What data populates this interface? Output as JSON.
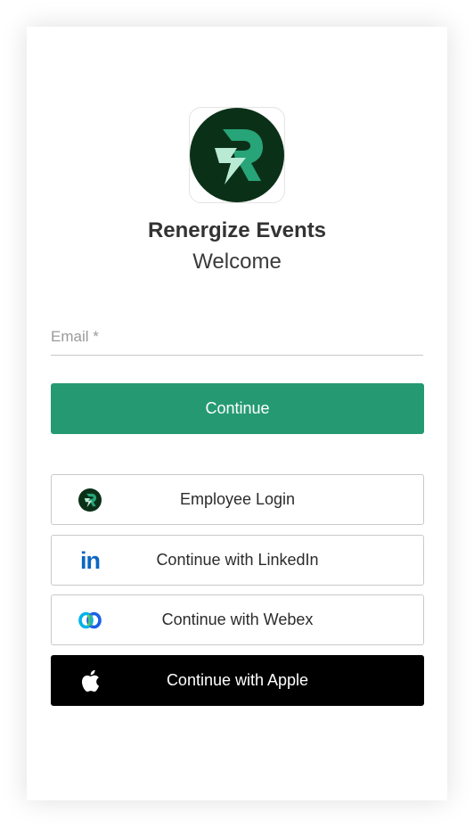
{
  "brand": {
    "name": "Renergize Events",
    "welcome": "Welcome"
  },
  "email": {
    "placeholder": "Email *",
    "value": ""
  },
  "continue_label": "Continue",
  "sso": [
    {
      "label": "Employee Login",
      "icon": "renergize-logo-icon"
    },
    {
      "label": "Continue with LinkedIn",
      "icon": "linkedin-icon"
    },
    {
      "label": "Continue with Webex",
      "icon": "webex-icon"
    },
    {
      "label": "Continue with Apple",
      "icon": "apple-icon"
    }
  ],
  "colors": {
    "primary": "#259a72",
    "logo_bg": "#0b3018",
    "logo_accent": "#27a478",
    "linkedin": "#0a66c2",
    "apple_bg": "#000000"
  }
}
